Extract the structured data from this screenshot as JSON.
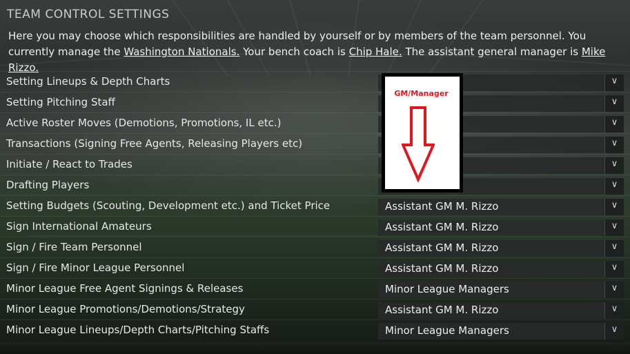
{
  "header": {
    "title": "TEAM CONTROL SETTINGS"
  },
  "description": {
    "part1": "Here you may choose which responsibilities are handled by yourself or by members of the team personnel. You currently manage the ",
    "team_link": "Washington Nationals.",
    "part2": " Your bench coach is ",
    "coach_link": "Chip Hale.",
    "part3": " The assistant general manager is ",
    "agm_link": "Mike Rizzo."
  },
  "rows": [
    {
      "label": "Setting Lineups & Depth Charts",
      "value": ""
    },
    {
      "label": "Setting Pitching Staff",
      "value": ""
    },
    {
      "label": "Active Roster Moves (Demotions, Promotions, IL etc.)",
      "value": ""
    },
    {
      "label": "Transactions (Signing Free Agents, Releasing Players etc)",
      "value": ""
    },
    {
      "label": "Initiate / React to Trades",
      "value": ""
    },
    {
      "label": "Drafting Players",
      "value": ""
    },
    {
      "label": "Setting Budgets (Scouting, Development etc.) and Ticket Price",
      "value": "Assistant GM M. Rizzo"
    },
    {
      "label": "Sign International Amateurs",
      "value": "Assistant GM M. Rizzo"
    },
    {
      "label": "Sign / Fire Team Personnel",
      "value": "Assistant GM M. Rizzo"
    },
    {
      "label": "Sign / Fire Minor League Personnel",
      "value": "Assistant GM M. Rizzo"
    },
    {
      "label": "Minor League Free Agent Signings & Releases",
      "value": "Minor League Managers"
    },
    {
      "label": "Minor League Promotions/Demotions/Strategy",
      "value": "Assistant GM M. Rizzo"
    },
    {
      "label": "Minor League Lineups/Depth Charts/Pitching Staffs",
      "value": "Minor League Managers"
    }
  ],
  "dropdown_icon": "chevron-down-icon",
  "annotation": {
    "label": "GM/Manager",
    "color": "#e0171f",
    "icon": "down-arrow-icon"
  }
}
